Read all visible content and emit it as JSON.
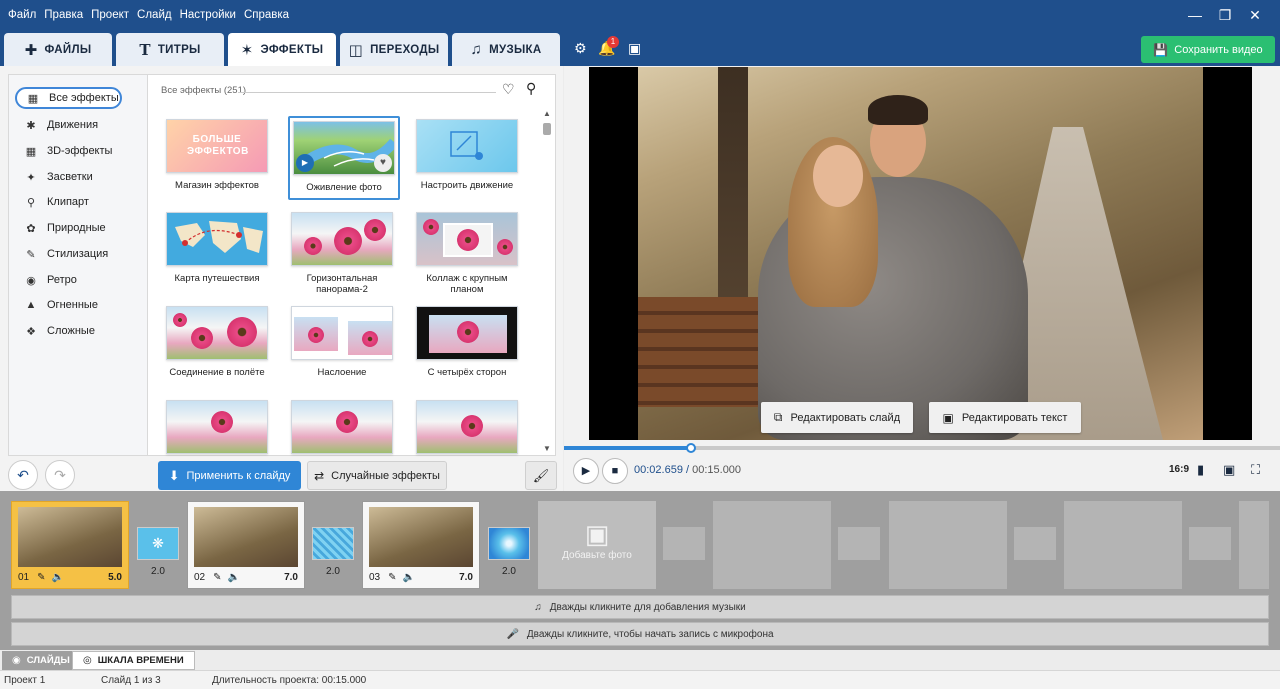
{
  "menu": [
    "Файл",
    "Правка",
    "Проект",
    "Слайд",
    "Настройки",
    "Справка"
  ],
  "tabs": [
    {
      "label": "ФАЙЛЫ",
      "icon": "file-add-icon"
    },
    {
      "label": "ТИТРЫ",
      "icon": "text-icon"
    },
    {
      "label": "ЭФФЕКТЫ",
      "icon": "effects-star-icon",
      "active": true
    },
    {
      "label": "ПЕРЕХОДЫ",
      "icon": "transitions-icon"
    },
    {
      "label": "МУЗЫКА",
      "icon": "music-note-icon"
    }
  ],
  "toolbar": {
    "notifications_count": "1",
    "save_label": "Сохранить видео"
  },
  "categories": [
    {
      "label": "Все эффекты",
      "icon": "grid-icon",
      "active": true
    },
    {
      "label": "Движения",
      "icon": "running-icon"
    },
    {
      "label": "3D-эффекты",
      "icon": "cube-icon"
    },
    {
      "label": "Засветки",
      "icon": "sparkle-icon"
    },
    {
      "label": "Клипарт",
      "icon": "pin-icon"
    },
    {
      "label": "Природные",
      "icon": "leaf-icon"
    },
    {
      "label": "Стилизация",
      "icon": "brush-icon"
    },
    {
      "label": "Ретро",
      "icon": "camera-icon"
    },
    {
      "label": "Огненные",
      "icon": "flame-icon"
    },
    {
      "label": "Сложные",
      "icon": "puzzle-icon"
    }
  ],
  "effects": {
    "header": "Все эффекты (251)",
    "shop_banner": "БОЛЬШЕ ЭФФЕКТОВ",
    "items": [
      {
        "label": "Магазин эффектов"
      },
      {
        "label": "Оживление фото",
        "selected": true
      },
      {
        "label": "Настроить движение"
      },
      {
        "label": "Карта путешествия"
      },
      {
        "label": "Горизонтальная панорама-2"
      },
      {
        "label": "Коллаж с крупным планом"
      },
      {
        "label": "Соединение в полёте"
      },
      {
        "label": "Наслоение"
      },
      {
        "label": "С четырёх сторон"
      },
      {
        "label": ""
      },
      {
        "label": ""
      },
      {
        "label": ""
      }
    ]
  },
  "actions": {
    "apply_label": "Применить к слайду",
    "random_label": "Случайные эффекты"
  },
  "preview": {
    "edit_slide_label": "Редактировать слайд",
    "edit_text_label": "Редактировать текст",
    "current_time": "00:02.659",
    "separator": " / ",
    "total_time": "00:15.000",
    "progress_fraction": 0.177,
    "aspect_ratio": "16:9"
  },
  "timeline": {
    "slides": [
      {
        "num": "01",
        "duration": "5.0",
        "selected": true
      },
      {
        "num": "02",
        "duration": "7.0"
      },
      {
        "num": "03",
        "duration": "7.0"
      }
    ],
    "transitions": [
      {
        "duration": "2.0"
      },
      {
        "duration": "2.0"
      },
      {
        "duration": "2.0"
      }
    ],
    "add_photo_label": "Добавьте фото",
    "music_hint": "Дважды кликните для добавления музыки",
    "mic_hint": "Дважды кликните, чтобы начать запись с микрофона"
  },
  "bottom_tabs": [
    {
      "label": "СЛАЙДЫ"
    },
    {
      "label": "ШКАЛА ВРЕМЕНИ",
      "active": true
    }
  ],
  "status": {
    "project": "Проект 1",
    "slide": "Слайд 1 из 3",
    "duration": "Длительность проекта: 00:15.000"
  },
  "colors": {
    "titlebar": "#1f4f8c",
    "accent": "#2f86d6",
    "save": "#2bbf72",
    "selected_slide": "#f5c145"
  }
}
